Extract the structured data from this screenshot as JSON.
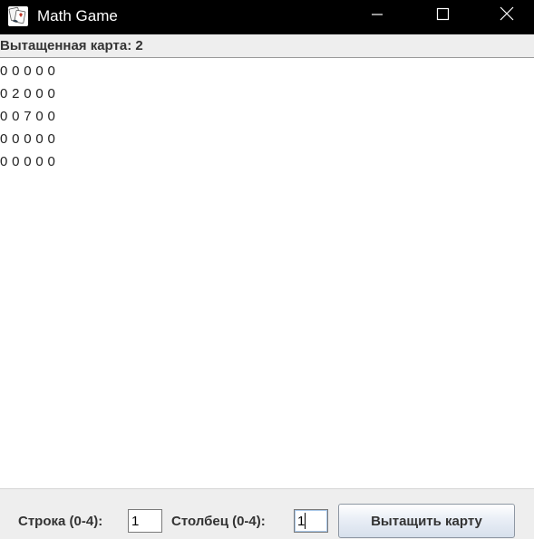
{
  "window": {
    "title": "Math Game",
    "icon": "java-cup-icon",
    "controls": [
      "minimize-icon",
      "maximize-icon",
      "close-icon"
    ]
  },
  "header": {
    "drawn_card_label": "Вытащенная карта: 2"
  },
  "grid": {
    "rows": [
      "0 0 0 0 0",
      "0 2 0 0 0",
      "0 0 7 0 0",
      "0 0 0 0 0",
      "0 0 0 0 0"
    ]
  },
  "controls": {
    "row_label": "Строка (0-4):",
    "row_value": "1",
    "col_label": "Столбец (0-4):",
    "col_value": "1",
    "draw_button_label": "Вытащить карту"
  },
  "colors": {
    "titlebar": "#000000",
    "panel": "#eeeeee",
    "button_border": "#8e97a3"
  }
}
